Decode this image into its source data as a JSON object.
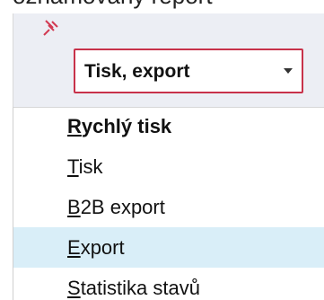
{
  "top_fragment": "oznamovany report",
  "pin_icon": "pin-icon",
  "select": {
    "value": "Tisk, export"
  },
  "menu": {
    "items": [
      {
        "mnemonic": "R",
        "rest": "ychlý tisk"
      },
      {
        "mnemonic": "T",
        "rest": "isk"
      },
      {
        "mnemonic": "B",
        "rest": "2B export"
      },
      {
        "mnemonic": "E",
        "rest": "xport"
      },
      {
        "mnemonic": "S",
        "rest": "tatistika stavů"
      }
    ]
  },
  "colors": {
    "accent_red": "#c8324a",
    "hover_blue": "#d9eef8",
    "panel_bg": "#eceef4"
  }
}
